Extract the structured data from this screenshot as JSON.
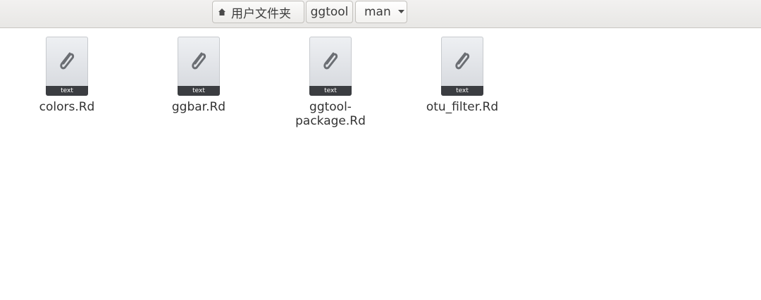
{
  "breadcrumb": {
    "items": [
      {
        "label": "用户文件夹",
        "icon": "home-icon"
      },
      {
        "label": "ggtool"
      },
      {
        "label": "man",
        "icon": "dropdown-arrow-icon"
      }
    ]
  },
  "files": [
    {
      "name": "colors.Rd",
      "type_label": "text",
      "icon": "paperclip-icon"
    },
    {
      "name": "ggbar.Rd",
      "type_label": "text",
      "icon": "paperclip-icon"
    },
    {
      "name_line1": "ggtool-",
      "name_line2": "package.Rd",
      "type_label": "text",
      "icon": "paperclip-icon"
    },
    {
      "name": "otu_filter.Rd",
      "type_label": "text",
      "icon": "paperclip-icon"
    }
  ],
  "colors": {
    "toolbar_bg": "#edecea",
    "file_label_bg": "#3b3d41",
    "icon_stroke": "#6b6e73"
  }
}
